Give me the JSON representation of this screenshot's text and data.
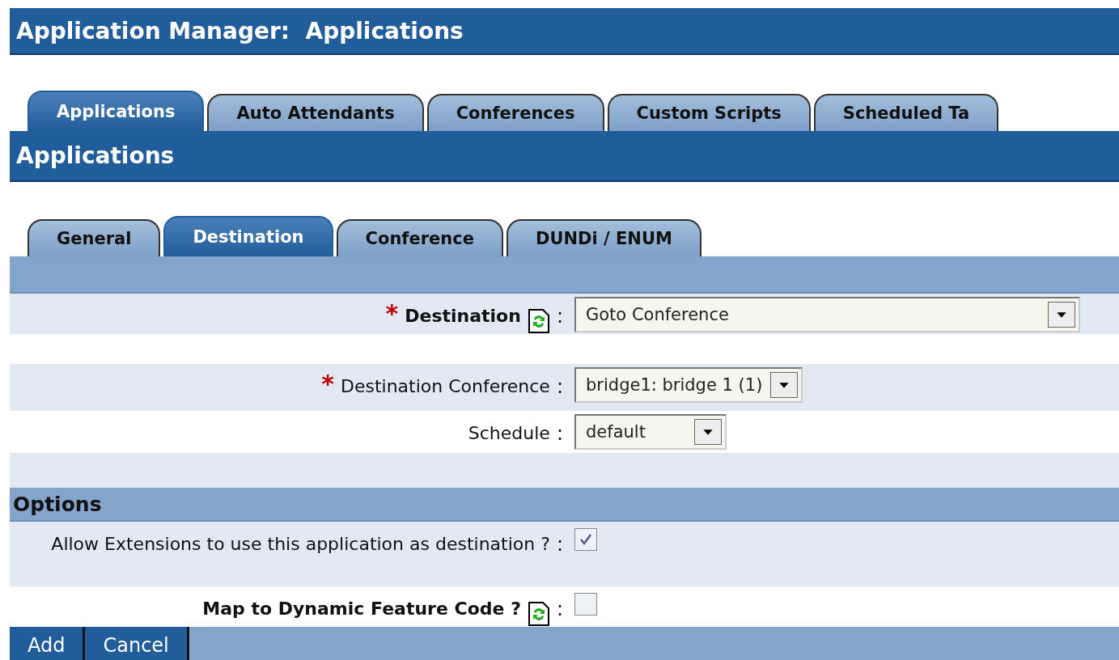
{
  "window": {
    "title": "Application Manager:  Applications"
  },
  "main_tabs": [
    {
      "label": "Applications",
      "selected": true
    },
    {
      "label": "Auto Attendants",
      "selected": false
    },
    {
      "label": "Conferences",
      "selected": false
    },
    {
      "label": "Custom Scripts",
      "selected": false
    },
    {
      "label": "Scheduled Ta",
      "selected": false
    }
  ],
  "section_title": "Applications",
  "sub_tabs": [
    {
      "label": "General",
      "selected": false
    },
    {
      "label": "Destination",
      "selected": true
    },
    {
      "label": "Conference",
      "selected": false
    },
    {
      "label": "DUNDi / ENUM",
      "selected": false
    }
  ],
  "destination_fields": [
    {
      "kind": "select",
      "marker": "*",
      "label": "Destination",
      "bold": true,
      "help": true,
      "colon": ":",
      "value": "Goto Conference"
    },
    {
      "kind": "select",
      "marker": "*",
      "label": "Destination Conference",
      "bold": false,
      "help": false,
      "colon": ":",
      "value": "bridge1: bridge 1 (1)"
    },
    {
      "kind": "select",
      "label": "Schedule",
      "bold": false,
      "help": false,
      "colon": ":",
      "value": "default"
    }
  ],
  "options": {
    "title": "Options",
    "fields": [
      {
        "kind": "checkbox",
        "label": "Allow Extensions to use this application as destination ?",
        "bold": false,
        "help": false,
        "colon": ":",
        "checked": true
      },
      {
        "kind": "checkbox",
        "label": "Map to Dynamic Feature Code ?",
        "bold": true,
        "help": true,
        "colon": ":",
        "checked": false
      }
    ]
  },
  "buttons": [
    "Add",
    "Cancel"
  ]
}
